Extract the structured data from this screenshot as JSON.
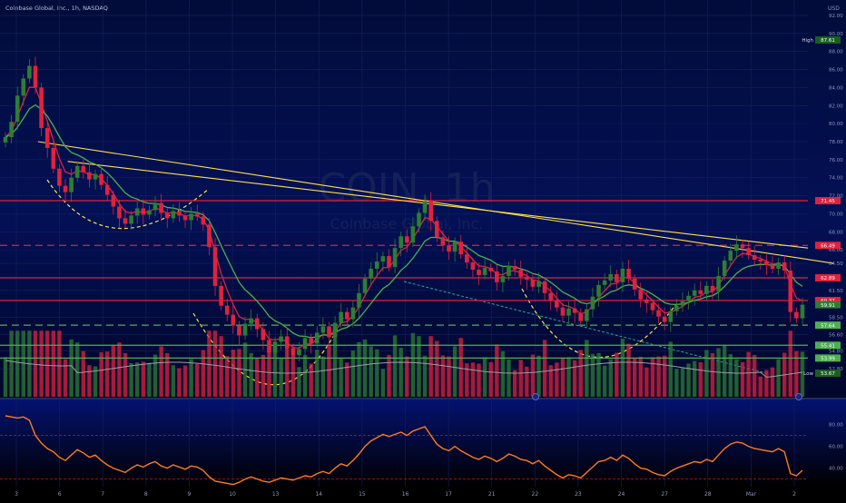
{
  "header": {
    "symbol_title": "Coinbase Global, Inc., 1h, NASDAQ",
    "currency": "USD"
  },
  "watermark": {
    "ticker": "COIN, 1h",
    "company": "Coinbase Global, Inc."
  },
  "colors": {
    "background_top": "#020c3a",
    "background_bottom": "#000000",
    "candle_up": "#2e7d32",
    "candle_down": "#e0223c",
    "ema_fast": "#e0223c",
    "ema_slow": "#4caf50",
    "trendline": "#ffe04a",
    "resistance": "#e0223c",
    "support": "#4caf50",
    "rsi_line": "#ff7a1a",
    "volume_avg": "#9e9e9e",
    "fib_channel": "#26a69a"
  },
  "chart_data": [
    {
      "type": "candlestick",
      "title": "Coinbase Global, Inc., 1h, NASDAQ",
      "ylim": [
        50.2,
        92.2
      ],
      "y_ticks": [
        52.8,
        54.8,
        56.6,
        58.5,
        61.5,
        64.5,
        66.0,
        68.0,
        70.0,
        72.0,
        74.0,
        76.0,
        78.0,
        80.0,
        82.0,
        84.0,
        86.0,
        88.0,
        90.0,
        92.0
      ],
      "y_tick_labels": [
        "52.80",
        "54.80",
        "56.60",
        "58.50",
        "61.50",
        "64.50",
        "66.00",
        "68.00",
        "70.00",
        "72.00",
        "74.00",
        "76.00",
        "78.00",
        "80.00",
        "82.00",
        "84.00",
        "86.00",
        "88.00",
        "90.00",
        "92.00"
      ],
      "x_tick_labels": [
        "3",
        "6",
        "7",
        "8",
        "9",
        "10",
        "13",
        "14",
        "15",
        "16",
        "17",
        "21",
        "22",
        "23",
        "24",
        "27",
        "28",
        "Mar",
        "2"
      ],
      "high_label": "High",
      "high_value": "87.61",
      "low_label": "Low",
      "low_value": "53.67",
      "price_levels": [
        {
          "value": 71.45,
          "label": "71.45",
          "style": "solid",
          "color": "#e0223c"
        },
        {
          "value": 66.49,
          "label": "66.49",
          "style": "dashed",
          "color": "#e0223c"
        },
        {
          "value": 62.89,
          "label": "62.89",
          "style": "solid",
          "color": "#e0223c"
        },
        {
          "value": 60.37,
          "label": "60.37",
          "style": "solid",
          "color": "#e0223c"
        },
        {
          "value": 57.64,
          "label": "57.64",
          "style": "dashed",
          "color": "#4caf50"
        },
        {
          "value": 55.41,
          "label": "55.41",
          "style": "solid",
          "color": "#4caf50"
        },
        {
          "value": 53.99,
          "label": "53.99",
          "style": "solid",
          "color": "#4caf50"
        }
      ],
      "last_price": {
        "value": 59.91,
        "label": "59.91"
      },
      "trendlines": [
        {
          "from": [
            0.045,
            78.0
          ],
          "to": [
            0.985,
            64.5
          ],
          "color": "#ffe04a"
        },
        {
          "from": [
            0.08,
            75.8
          ],
          "to": [
            0.955,
            66.2
          ],
          "color": "#ffe04a"
        }
      ],
      "close": [
        78.5,
        80.2,
        83.1,
        85.0,
        86.4,
        84.0,
        79.5,
        77.3,
        75.0,
        73.1,
        72.4,
        74.0,
        75.3,
        74.6,
        73.8,
        74.4,
        73.2,
        72.1,
        70.8,
        69.5,
        68.9,
        69.8,
        70.6,
        69.9,
        70.4,
        71.2,
        70.1,
        69.5,
        70.3,
        69.8,
        69.3,
        70.0,
        69.7,
        68.8,
        66.3,
        62.0,
        59.8,
        58.8,
        57.6,
        56.5,
        57.8,
        58.4,
        57.2,
        56.0,
        54.6,
        55.8,
        56.4,
        55.1,
        54.3,
        55.0,
        56.2,
        55.6,
        56.8,
        57.5,
        56.3,
        57.9,
        59.1,
        58.3,
        59.6,
        61.2,
        62.8,
        63.9,
        64.7,
        65.3,
        64.1,
        66.2,
        67.5,
        66.8,
        68.6,
        70.1,
        71.4,
        69.2,
        67.4,
        66.5,
        65.8,
        66.9,
        65.5,
        64.6,
        63.8,
        63.2,
        64.0,
        63.6,
        62.4,
        63.1,
        64.2,
        63.8,
        63.0,
        62.7,
        61.9,
        62.5,
        61.2,
        60.4,
        59.6,
        58.7,
        59.5,
        59.0,
        58.1,
        59.4,
        60.8,
        62.1,
        62.6,
        63.3,
        62.4,
        63.9,
        62.8,
        61.6,
        60.5,
        60.1,
        59.3,
        58.6,
        58.0,
        59.2,
        59.8,
        60.3,
        60.9,
        61.5,
        61.1,
        62.0,
        61.4,
        63.1,
        64.8,
        65.9,
        66.6,
        66.2,
        65.4,
        64.9,
        64.7,
        64.3,
        63.9,
        64.6,
        63.7,
        59.1,
        58.4,
        59.91
      ],
      "volume_scale": [
        40,
        100
      ],
      "rsi": {
        "ylim": [
          28,
          98
        ],
        "y_ticks": [
          40,
          60,
          80
        ],
        "y_tick_labels": [
          "40.00",
          "60.00",
          "80.00"
        ],
        "levels": [
          70,
          30
        ],
        "values": [
          88,
          87,
          86,
          87,
          84,
          70,
          63,
          58,
          55,
          50,
          47,
          52,
          57,
          54,
          50,
          52,
          47,
          43,
          40,
          38,
          36,
          40,
          43,
          41,
          44,
          46,
          42,
          40,
          43,
          41,
          39,
          42,
          41,
          38,
          32,
          28,
          27,
          26,
          25,
          27,
          30,
          32,
          30,
          28,
          27,
          29,
          31,
          30,
          29,
          31,
          33,
          32,
          35,
          37,
          35,
          40,
          44,
          42,
          47,
          53,
          60,
          65,
          68,
          71,
          69,
          71,
          73,
          70,
          74,
          76,
          78,
          70,
          62,
          58,
          56,
          60,
          56,
          53,
          50,
          48,
          51,
          49,
          46,
          49,
          53,
          51,
          48,
          47,
          44,
          47,
          42,
          38,
          34,
          31,
          34,
          33,
          31,
          36,
          41,
          46,
          47,
          50,
          47,
          52,
          49,
          44,
          40,
          39,
          36,
          34,
          33,
          37,
          40,
          42,
          44,
          46,
          45,
          48,
          46,
          52,
          58,
          62,
          64,
          63,
          60,
          58,
          57,
          56,
          55,
          58,
          55,
          35,
          33,
          38
        ]
      }
    }
  ]
}
